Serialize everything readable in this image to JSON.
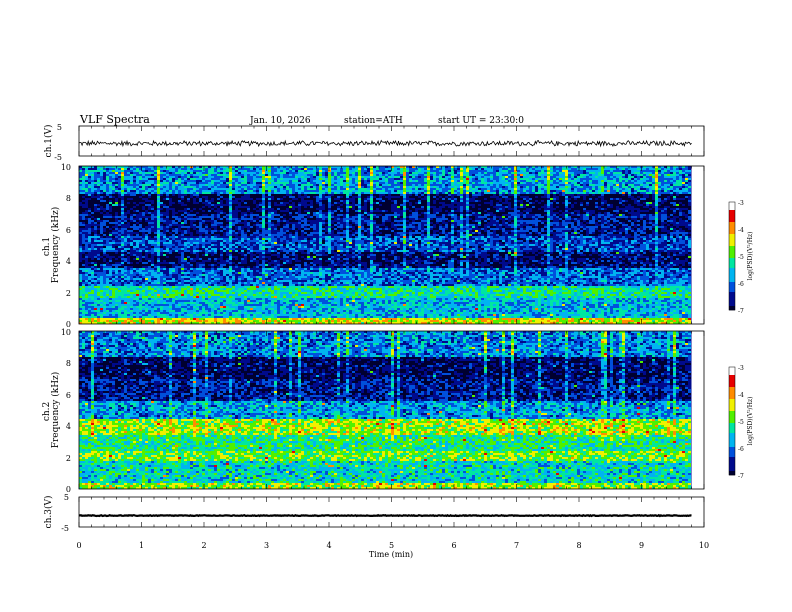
{
  "header": {
    "title": "VLF Spectra",
    "date": "Jan. 10, 2026",
    "station": "station=ATH",
    "start_ut": "start UT = 23:30:0"
  },
  "colors": {
    "colormap": [
      "#000030",
      "#000a8c",
      "#0050dc",
      "#00b4f0",
      "#00e6a0",
      "#50f000",
      "#f0f000",
      "#ff8c00",
      "#e60000",
      "#ffffff"
    ],
    "trace": "#000000",
    "frame": "#000000"
  },
  "chart_data": [
    {
      "type": "line",
      "panel": "ch1-waveform",
      "ylabel": "ch.1(V)",
      "ylim": [
        -5,
        5
      ],
      "yticks": [
        "5",
        "-5"
      ],
      "x_range_min": [
        0,
        9.8
      ],
      "baseline_v": -0.8,
      "amplitude_v": 1.0
    },
    {
      "type": "heatmap",
      "panel": "ch1-spectrogram",
      "ylabel": "ch.1\nFrequency (kHz)",
      "ylim": [
        0,
        10
      ],
      "yticks": [
        "0",
        "2",
        "4",
        "6",
        "8",
        "10"
      ],
      "x_range_min": [
        0,
        9.8
      ],
      "colorbar": {
        "label": "log(PSD)(V²/Hz)",
        "range": [
          -7,
          -3
        ],
        "ticks": [
          "-3",
          "-4",
          "-5",
          "-6",
          "-7"
        ]
      },
      "bands_khz": [
        [
          0,
          0.4,
          -4.2
        ],
        [
          0.4,
          1.6,
          -5.4
        ],
        [
          1.6,
          2.4,
          -5.0
        ],
        [
          2.4,
          3.6,
          -5.8
        ],
        [
          3.6,
          4.6,
          -6.5
        ],
        [
          4.6,
          5.6,
          -6.0
        ],
        [
          5.6,
          7.0,
          -6.3
        ],
        [
          7.0,
          8.2,
          -6.6
        ],
        [
          8.2,
          10,
          -5.6
        ]
      ]
    },
    {
      "type": "heatmap",
      "panel": "ch2-spectrogram",
      "ylabel": "ch.2\nFrequency (kHz)",
      "ylim": [
        0,
        10
      ],
      "yticks": [
        "0",
        "2",
        "4",
        "6",
        "8",
        "10"
      ],
      "x_range_min": [
        0,
        9.8
      ],
      "colorbar": {
        "label": "log(PSD)(V²/Hz)",
        "range": [
          -7,
          -3
        ],
        "ticks": [
          "-3",
          "-4",
          "-5",
          "-6",
          "-7"
        ]
      },
      "bands_khz": [
        [
          0,
          0.4,
          -4.4
        ],
        [
          0.4,
          1.8,
          -5.2
        ],
        [
          1.8,
          2.4,
          -4.6
        ],
        [
          2.4,
          3.4,
          -4.9
        ],
        [
          3.4,
          4.4,
          -4.4
        ],
        [
          4.4,
          5.6,
          -5.6
        ],
        [
          5.6,
          7.0,
          -6.3
        ],
        [
          7.0,
          8.4,
          -6.6
        ],
        [
          8.4,
          10,
          -5.7
        ]
      ]
    },
    {
      "type": "line",
      "panel": "ch3-waveform",
      "ylabel": "ch.3(V)",
      "ylim": [
        -5,
        5
      ],
      "yticks": [
        "5",
        "-5"
      ],
      "x_range_min": [
        0,
        9.8
      ],
      "baseline_v": -1.2,
      "amplitude_v": 0.15
    }
  ],
  "xaxis": {
    "label": "Time (min)",
    "range": [
      0,
      10
    ],
    "ticks": [
      "0",
      "1",
      "2",
      "3",
      "4",
      "5",
      "6",
      "7",
      "8",
      "9",
      "10"
    ]
  }
}
